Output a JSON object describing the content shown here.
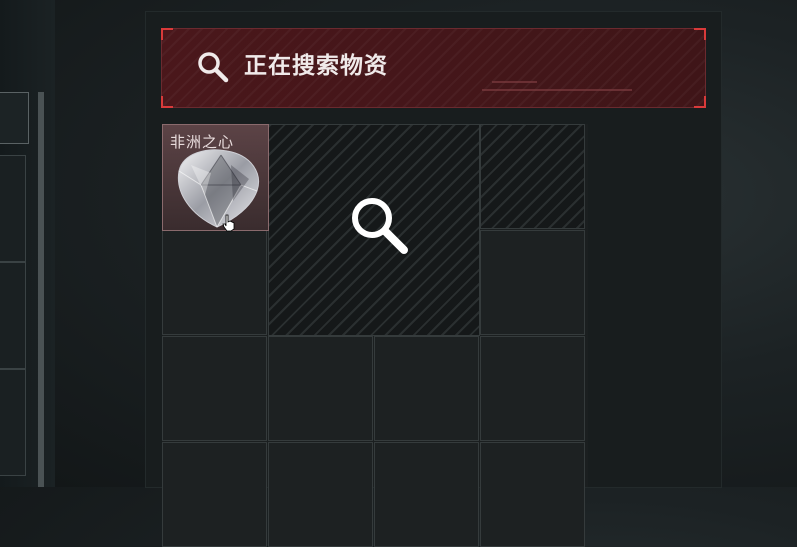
{
  "search_header": {
    "title": "正在搜索物资",
    "icon": "search-icon",
    "accent_color": "#d93a3a"
  },
  "inventory": {
    "item": {
      "name": "非洲之心",
      "icon": "diamond-gem-icon"
    },
    "search_slot_icon": "search-icon"
  }
}
